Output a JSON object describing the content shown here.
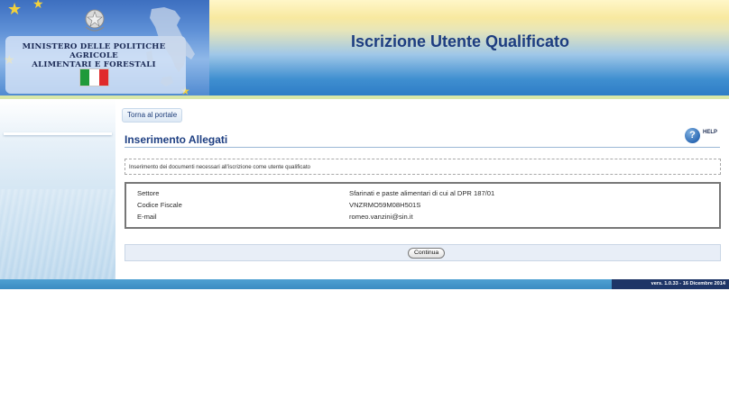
{
  "header": {
    "ministry_line1": "MINISTERO DELLE POLITICHE AGRICOLE",
    "ministry_line2": "ALIMENTARI E FORESTALI",
    "app_title": "Iscrizione Utente Qualificato",
    "flag_colors": [
      "#1f9a3a",
      "#ffffff",
      "#e02b2b"
    ]
  },
  "nav": {
    "back_label": "Torna al portale"
  },
  "page": {
    "section_title": "Inserimento Allegati",
    "help_label": "HELP",
    "help_icon": "?",
    "info_text": "Inserimento dei documenti necessari all'iscrizione come utente qualificato"
  },
  "details": [
    {
      "label": "Settore",
      "value": "Sfarinati e paste alimentari di cui al DPR 187/01"
    },
    {
      "label": "Codice Fiscale",
      "value": "VNZRMO59M08H501S"
    },
    {
      "label": "E-mail",
      "value": "romeo.vanzini@sin.it"
    }
  ],
  "actions": {
    "continue_label": "Continua"
  },
  "footer": {
    "version": "vers. 1.0.33 - 16 Dicembre 2014"
  },
  "colors": {
    "title_blue": "#1e3f82",
    "footer_blue": "#3b8cc2",
    "footer_dark": "#1e3567"
  }
}
